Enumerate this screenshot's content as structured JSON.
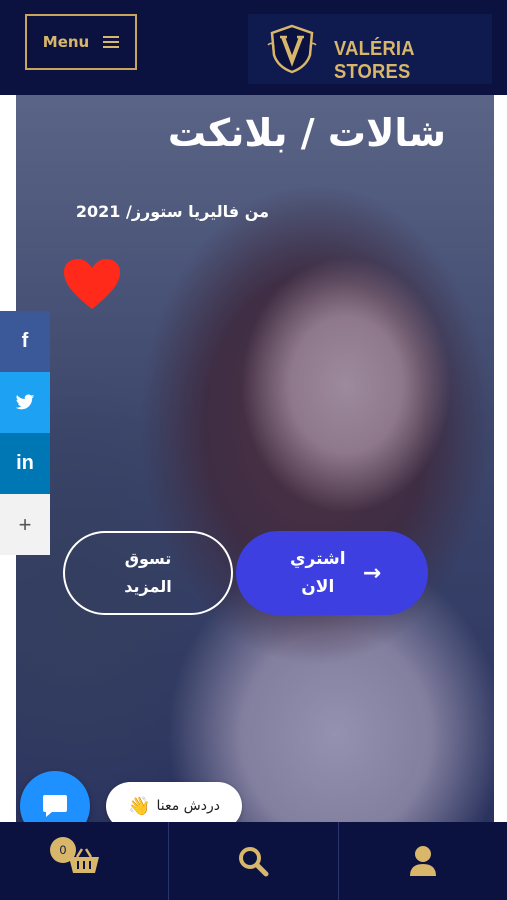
{
  "header": {
    "menu_label": "Menu",
    "brand_name": "VALÉRIA STORES"
  },
  "hero": {
    "title": "شالات / بلانكت",
    "subtitle": "من فاليريا ستورز/ 2021",
    "buy_line1": "اشتري",
    "buy_line2": "الان",
    "buy_arrow": "→",
    "more_line1": "تسوق",
    "more_line2": "المزيد"
  },
  "social": {
    "facebook": "f",
    "twitter": "t",
    "linkedin": "in",
    "more": "+"
  },
  "chat": {
    "label": "دردش معنا",
    "wave_emoji": "👋"
  },
  "bottom_nav": {
    "cart_count": "0",
    "icons": [
      "basket-icon",
      "search-icon",
      "user-icon"
    ]
  },
  "colors": {
    "navy": "#0b1240",
    "gold": "#d8b66a",
    "primary_button": "#3d3fe0",
    "heart": "#ff2a1a",
    "chat_blue": "#1e90ff"
  }
}
